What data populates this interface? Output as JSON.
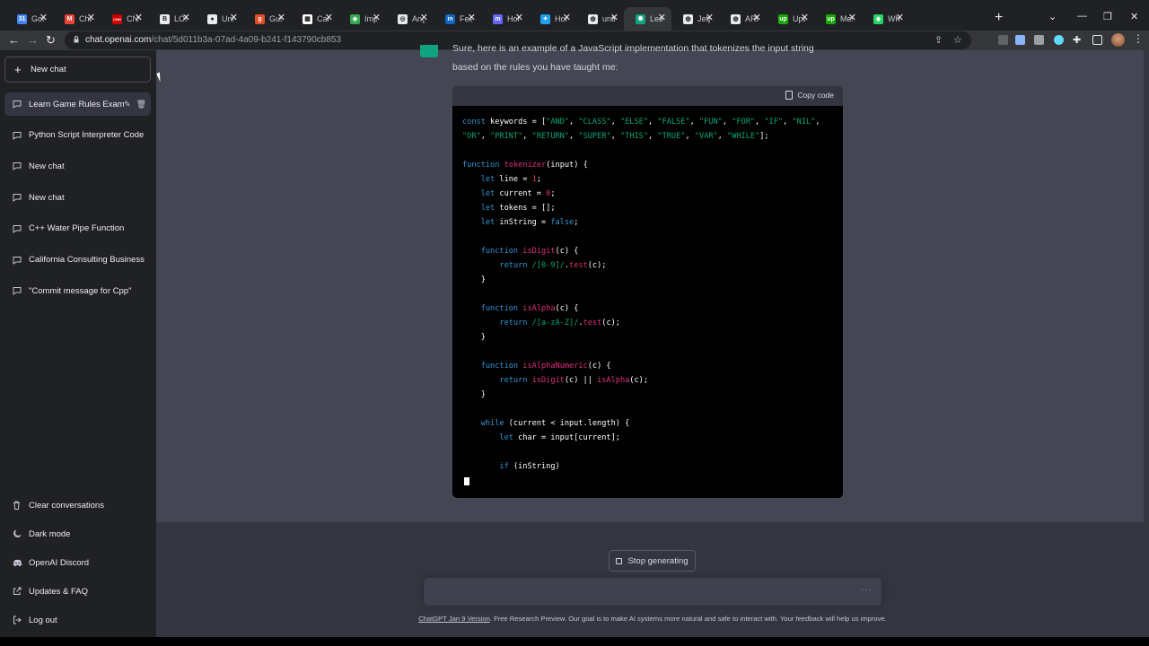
{
  "browser": {
    "tabs": [
      {
        "label": "Goo",
        "icon": "google-calendar-icon",
        "color": "#4285f4",
        "glyph": "31"
      },
      {
        "label": "Chat",
        "icon": "gmail-icon",
        "color": "#ea4335",
        "glyph": "M"
      },
      {
        "label": "CNN",
        "icon": "cnn-icon",
        "color": "#cc0000",
        "glyph": "CNN"
      },
      {
        "label": "LON",
        "icon": "book-icon",
        "color": "#e8eaed",
        "glyph": "B"
      },
      {
        "label": "Unre",
        "icon": "github-icon",
        "color": "#e8eaed",
        "glyph": "●"
      },
      {
        "label": "Gust",
        "icon": "g-icon",
        "color": "#e34c26",
        "glyph": "g"
      },
      {
        "label": "Calif",
        "icon": "document-icon",
        "color": "#ffffff",
        "glyph": "▦"
      },
      {
        "label": "Imp",
        "icon": "leaf-icon",
        "color": "#34a853",
        "glyph": "◈"
      },
      {
        "label": "Ang",
        "icon": "target-icon",
        "color": "#e8eaed",
        "glyph": "◎"
      },
      {
        "label": "Feed",
        "icon": "linkedin-icon",
        "color": "#0a66c2",
        "glyph": "in"
      },
      {
        "label": "Hon",
        "icon": "mastodon-icon",
        "color": "#6364ff",
        "glyph": "m"
      },
      {
        "label": "Hon",
        "icon": "twitter-icon",
        "color": "#1da1f2",
        "glyph": "✦"
      },
      {
        "label": "unti",
        "icon": "globe-icon",
        "color": "#e8eaed",
        "glyph": "◍"
      },
      {
        "label": "Lear",
        "icon": "openai-icon",
        "color": "#10a37f",
        "glyph": "✺"
      },
      {
        "label": "Jetp",
        "icon": "globe-icon",
        "color": "#e8eaed",
        "glyph": "◍"
      },
      {
        "label": "ARK",
        "icon": "globe-icon",
        "color": "#e8eaed",
        "glyph": "◍"
      },
      {
        "label": "Upw",
        "icon": "upwork-icon",
        "color": "#14a800",
        "glyph": "up"
      },
      {
        "label": "Mes",
        "icon": "upwork-icon",
        "color": "#14a800",
        "glyph": "up"
      },
      {
        "label": "Wha",
        "icon": "whatsapp-icon",
        "color": "#25d366",
        "glyph": "◆"
      }
    ],
    "active_tab": 13,
    "url_host": "chat.openai.com",
    "url_path": "/chat/5d011b3a-07ad-4a09-b241-f143790cb853"
  },
  "sidebar": {
    "new_chat_label": "New chat",
    "history": [
      {
        "label": "Learn Game Rules Exam",
        "selected": true
      },
      {
        "label": "Python Script Interpreter Code",
        "selected": false
      },
      {
        "label": "New chat",
        "selected": false
      },
      {
        "label": "New chat",
        "selected": false
      },
      {
        "label": "C++ Water Pipe Function",
        "selected": false
      },
      {
        "label": "California Consulting Business",
        "selected": false
      },
      {
        "label": "\"Commit message for Cpp\"",
        "selected": false
      }
    ],
    "bottom": [
      {
        "label": "Clear conversations",
        "icon": "trash-icon"
      },
      {
        "label": "Dark mode",
        "icon": "moon-icon"
      },
      {
        "label": "OpenAI Discord",
        "icon": "discord-icon"
      },
      {
        "label": "Updates & FAQ",
        "icon": "external-link-icon"
      },
      {
        "label": "Log out",
        "icon": "logout-icon"
      }
    ]
  },
  "conversation": {
    "intro_line1": "Sure, here is an example of a JavaScript implementation that tokenizes the input string",
    "intro_line2": "based on the rules you have taught me:",
    "copy_label": "Copy code",
    "code_lines": [
      [
        [
          "kw",
          "const"
        ],
        [
          "tx",
          " keywords = ["
        ],
        [
          "st",
          "\"AND\""
        ],
        [
          "tx",
          ", "
        ],
        [
          "st",
          "\"CLASS\""
        ],
        [
          "tx",
          ", "
        ],
        [
          "st",
          "\"ELSE\""
        ],
        [
          "tx",
          ", "
        ],
        [
          "st",
          "\"FALSE\""
        ],
        [
          "tx",
          ", "
        ],
        [
          "st",
          "\"FUN\""
        ],
        [
          "tx",
          ", "
        ],
        [
          "st",
          "\"FOR\""
        ],
        [
          "tx",
          ", "
        ],
        [
          "st",
          "\"IF\""
        ],
        [
          "tx",
          ", "
        ],
        [
          "st",
          "\"NIL\""
        ],
        [
          "tx",
          ","
        ]
      ],
      [
        [
          "st",
          "\"OR\""
        ],
        [
          "tx",
          ", "
        ],
        [
          "st",
          "\"PRINT\""
        ],
        [
          "tx",
          ", "
        ],
        [
          "st",
          "\"RETURN\""
        ],
        [
          "tx",
          ", "
        ],
        [
          "st",
          "\"SUPER\""
        ],
        [
          "tx",
          ", "
        ],
        [
          "st",
          "\"THIS\""
        ],
        [
          "tx",
          ", "
        ],
        [
          "st",
          "\"TRUE\""
        ],
        [
          "tx",
          ", "
        ],
        [
          "st",
          "\"VAR\""
        ],
        [
          "tx",
          ", "
        ],
        [
          "st",
          "\"WHILE\""
        ],
        [
          "tx",
          "];"
        ]
      ],
      [],
      [
        [
          "kw",
          "function"
        ],
        [
          "tx",
          " "
        ],
        [
          "fn",
          "tokenizer"
        ],
        [
          "tx",
          "(input) {"
        ]
      ],
      [
        [
          "tx",
          "    "
        ],
        [
          "kw",
          "let"
        ],
        [
          "tx",
          " line = "
        ],
        [
          "nm",
          "1"
        ],
        [
          "tx",
          ";"
        ]
      ],
      [
        [
          "tx",
          "    "
        ],
        [
          "kw",
          "let"
        ],
        [
          "tx",
          " current = "
        ],
        [
          "nm",
          "0"
        ],
        [
          "tx",
          ";"
        ]
      ],
      [
        [
          "tx",
          "    "
        ],
        [
          "kw",
          "let"
        ],
        [
          "tx",
          " tokens = [];"
        ]
      ],
      [
        [
          "tx",
          "    "
        ],
        [
          "kw",
          "let"
        ],
        [
          "tx",
          " inString = "
        ],
        [
          "kw",
          "false"
        ],
        [
          "tx",
          ";"
        ]
      ],
      [],
      [
        [
          "tx",
          "    "
        ],
        [
          "kw",
          "function"
        ],
        [
          "tx",
          " "
        ],
        [
          "fn",
          "isDigit"
        ],
        [
          "tx",
          "(c) {"
        ]
      ],
      [
        [
          "tx",
          "        "
        ],
        [
          "kw",
          "return"
        ],
        [
          "tx",
          " "
        ],
        [
          "st",
          "/[0-9]/"
        ],
        [
          "tx",
          "."
        ],
        [
          "fn",
          "test"
        ],
        [
          "tx",
          "(c);"
        ]
      ],
      [
        [
          "tx",
          "    }"
        ]
      ],
      [],
      [
        [
          "tx",
          "    "
        ],
        [
          "kw",
          "function"
        ],
        [
          "tx",
          " "
        ],
        [
          "fn",
          "isAlpha"
        ],
        [
          "tx",
          "(c) {"
        ]
      ],
      [
        [
          "tx",
          "        "
        ],
        [
          "kw",
          "return"
        ],
        [
          "tx",
          " "
        ],
        [
          "st",
          "/[a-zA-Z]/"
        ],
        [
          "tx",
          "."
        ],
        [
          "fn",
          "test"
        ],
        [
          "tx",
          "(c);"
        ]
      ],
      [
        [
          "tx",
          "    }"
        ]
      ],
      [],
      [
        [
          "tx",
          "    "
        ],
        [
          "kw",
          "function"
        ],
        [
          "tx",
          " "
        ],
        [
          "fn",
          "isAlphaNumeric"
        ],
        [
          "tx",
          "(c) {"
        ]
      ],
      [
        [
          "tx",
          "        "
        ],
        [
          "kw",
          "return"
        ],
        [
          "tx",
          " "
        ],
        [
          "fn",
          "isDigit"
        ],
        [
          "tx",
          "(c) || "
        ],
        [
          "fn",
          "isAlpha"
        ],
        [
          "tx",
          "(c);"
        ]
      ],
      [
        [
          "tx",
          "    }"
        ]
      ],
      [],
      [
        [
          "tx",
          "    "
        ],
        [
          "kw",
          "while"
        ],
        [
          "tx",
          " (current < input.length) {"
        ]
      ],
      [
        [
          "tx",
          "        "
        ],
        [
          "kw",
          "let"
        ],
        [
          "tx",
          " char = input[current];"
        ]
      ],
      [],
      [
        [
          "tx",
          "        "
        ],
        [
          "kw",
          "if"
        ],
        [
          "tx",
          " (inString)"
        ]
      ]
    ],
    "stop_label": "Stop generating"
  },
  "footer": {
    "link_text": "ChatGPT Jan 9 Version",
    "text": ". Free Research Preview. Our goal is to make AI systems more natural and safe to interact with. Your feedback will help us improve."
  },
  "colors": {
    "sidebar_bg": "#202123",
    "main_bg": "#343541",
    "message_bg": "#444654",
    "accent": "#10a37f"
  }
}
